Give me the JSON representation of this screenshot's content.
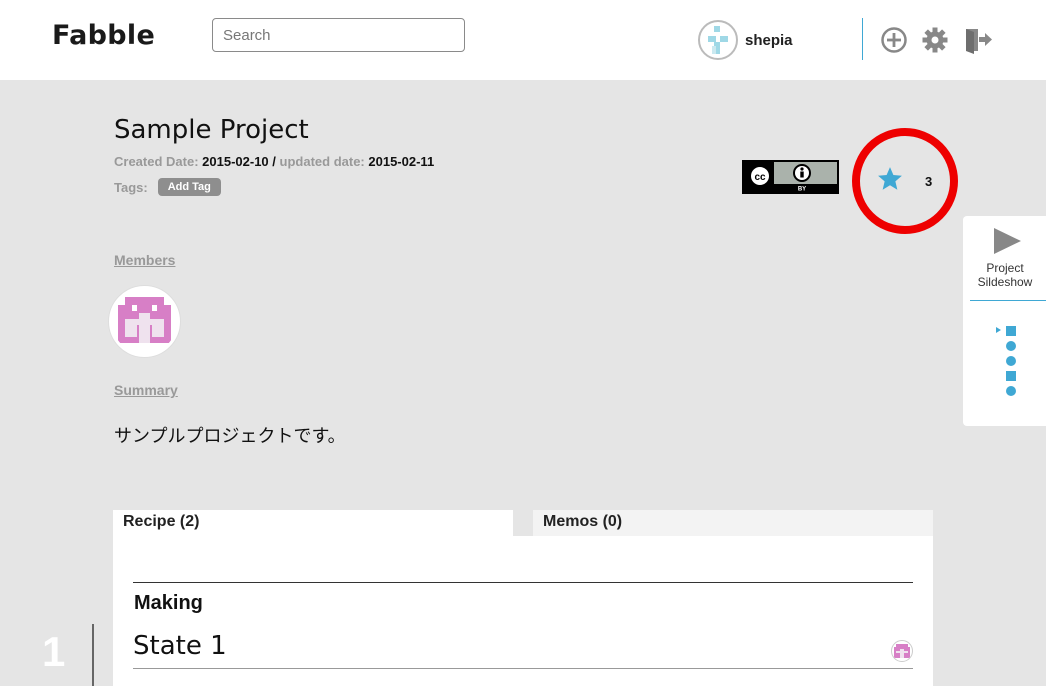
{
  "header": {
    "logo": "Fabble",
    "search_placeholder": "Search",
    "username": "shepia"
  },
  "project": {
    "title": "Sample Project",
    "created_label": "Created Date:",
    "created_date": "2015-02-10",
    "separator": "/",
    "updated_label": "updated date:",
    "updated_date": "2015-02-11",
    "tags_label": "Tags:",
    "add_tag": "Add Tag",
    "license_text": "BY",
    "star_count": "3"
  },
  "slideshow": {
    "label_line1": "Project",
    "label_line2": "Sildeshow"
  },
  "members": {
    "label": "Members"
  },
  "summary": {
    "label": "Summary",
    "text": "サンプルプロジェクトです。"
  },
  "tabs": [
    {
      "label": "Recipe (2)"
    },
    {
      "label": "Memos (0)"
    }
  ],
  "recipe": {
    "section": "Making",
    "state_title": "State 1",
    "step_number": "1"
  },
  "colors": {
    "accent": "#3fa8d4",
    "highlight_circle": "#ee0000",
    "avatar_pink": "#d77fc6"
  }
}
